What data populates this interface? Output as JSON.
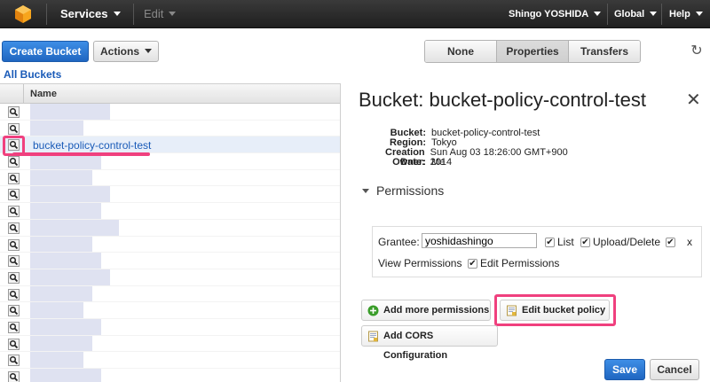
{
  "nav": {
    "services": "Services",
    "edit": "Edit",
    "user": "Shingo YOSHIDA",
    "region": "Global",
    "help": "Help"
  },
  "toolbar": {
    "create_bucket": "Create Bucket",
    "actions": "Actions",
    "view_none": "None",
    "view_properties": "Properties",
    "view_transfers": "Transfers"
  },
  "breadcrumb": "All Buckets",
  "list": {
    "column_name": "Name",
    "selected_bucket": "bucket-policy-control-test"
  },
  "panel": {
    "title": "Bucket: bucket-policy-control-test",
    "props": [
      {
        "key": "Bucket:",
        "value": "bucket-policy-control-test"
      },
      {
        "key": "Region:",
        "value": "Tokyo"
      },
      {
        "key": "Creation Date:",
        "value": "Sun Aug 03 18:26:00 GMT+900 2014"
      },
      {
        "key": "Owner:",
        "value": "Me"
      }
    ],
    "permissions_heading": "Permissions",
    "grantee_label": "Grantee:",
    "grantee_value": "yoshidashingo",
    "list_label": "List",
    "upload_delete_label": "Upload/Delete",
    "view_permissions_label": "View Permissions",
    "edit_permissions_label": "Edit Permissions",
    "remove_label": "x",
    "add_more_permissions": "Add more permissions",
    "edit_bucket_policy": "Edit bucket policy",
    "add_cors": "Add CORS Configuration",
    "save": "Save",
    "cancel": "Cancel"
  },
  "colors": {
    "accent_blue": "#1f66c1",
    "highlight_pink": "#f0407e"
  }
}
